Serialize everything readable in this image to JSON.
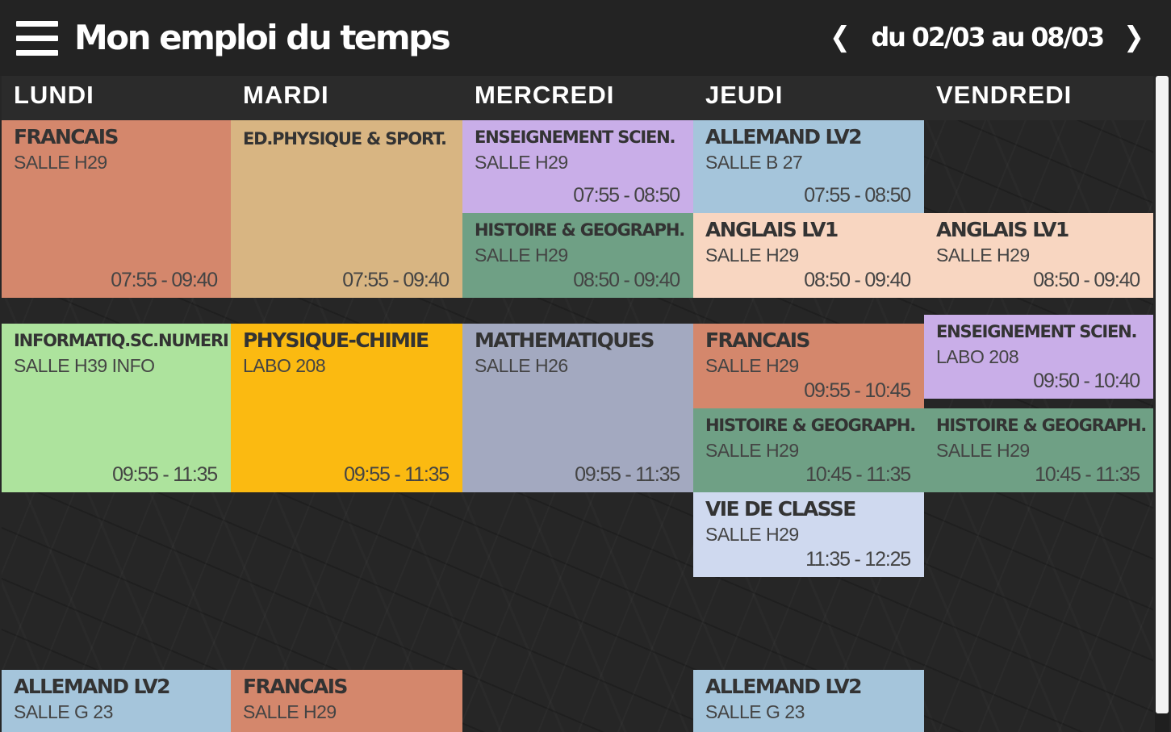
{
  "header": {
    "title": "Mon emploi du temps",
    "week_label": "du 02/03 au 08/03",
    "prev_icon": "chevron-left-icon",
    "next_icon": "chevron-right-icon",
    "menu_icon": "hamburger-menu-icon"
  },
  "days": [
    "LUNDI",
    "MARDI",
    "MERCREDI",
    "JEUDI",
    "VENDREDI"
  ],
  "lessons": [
    {
      "day": "LUNDI",
      "subject": "FRANCAIS",
      "room": "SALLE H29",
      "time": "07:55 - 09:40",
      "color": "#d4876c"
    },
    {
      "day": "MARDI",
      "subject": "ED.PHYSIQUE & SPORT.",
      "room": "",
      "time": "07:55 - 09:40",
      "color": "#d8b582"
    },
    {
      "day": "MERCREDI",
      "subject": "ENSEIGNEMENT SCIEN.",
      "room": "SALLE H29",
      "time": "07:55 - 08:50",
      "color": "#c9aee8"
    },
    {
      "day": "MERCREDI",
      "subject": "HISTOIRE & GEOGRAPH.",
      "room": "SALLE H29",
      "time": "08:50 - 09:40",
      "color": "#6fa085"
    },
    {
      "day": "JEUDI",
      "subject": "ALLEMAND LV2",
      "room": "SALLE B 27",
      "time": "07:55 - 08:50",
      "color": "#a5c5db"
    },
    {
      "day": "JEUDI",
      "subject": "ANGLAIS LV1",
      "room": "SALLE H29",
      "time": "08:50 - 09:40",
      "color": "#f8d6c1"
    },
    {
      "day": "VENDREDI",
      "subject": "ANGLAIS LV1",
      "room": "SALLE H29",
      "time": "08:50 - 09:40",
      "color": "#f8d6c1"
    },
    {
      "day": "LUNDI",
      "subject": "INFORMATIQ.SC.NUMERI",
      "room": "SALLE H39 INFO",
      "time": "09:55 - 11:35",
      "color": "#ade39d"
    },
    {
      "day": "MARDI",
      "subject": "PHYSIQUE-CHIMIE",
      "room": "LABO 208",
      "time": "09:55 - 11:35",
      "color": "#fbba11"
    },
    {
      "day": "MERCREDI",
      "subject": "MATHEMATIQUES",
      "room": "SALLE H26",
      "time": "09:55 - 11:35",
      "color": "#a3a9c0"
    },
    {
      "day": "JEUDI",
      "subject": "FRANCAIS",
      "room": "SALLE H29",
      "time": "09:55 - 10:45",
      "color": "#d4876c"
    },
    {
      "day": "VENDREDI",
      "subject": "ENSEIGNEMENT SCIEN.",
      "room": "LABO 208",
      "time": "09:50 - 10:40",
      "color": "#c9aee8"
    },
    {
      "day": "JEUDI",
      "subject": "HISTOIRE & GEOGRAPH.",
      "room": "SALLE H29",
      "time": "10:45 - 11:35",
      "color": "#6fa085"
    },
    {
      "day": "VENDREDI",
      "subject": "HISTOIRE & GEOGRAPH.",
      "room": "SALLE H29",
      "time": "10:45 - 11:35",
      "color": "#6fa085"
    },
    {
      "day": "JEUDI",
      "subject": "VIE DE CLASSE",
      "room": "SALLE H29",
      "time": "11:35 - 12:25",
      "color": "#cfd9ef"
    },
    {
      "day": "LUNDI",
      "subject": "ALLEMAND LV2",
      "room": "SALLE G 23",
      "time": "",
      "color": "#a5c5db"
    },
    {
      "day": "MARDI",
      "subject": "FRANCAIS",
      "room": "SALLE H29",
      "time": "",
      "color": "#d4876c"
    },
    {
      "day": "JEUDI",
      "subject": "ALLEMAND LV2",
      "room": "SALLE G 23",
      "time": "",
      "color": "#a5c5db"
    }
  ]
}
